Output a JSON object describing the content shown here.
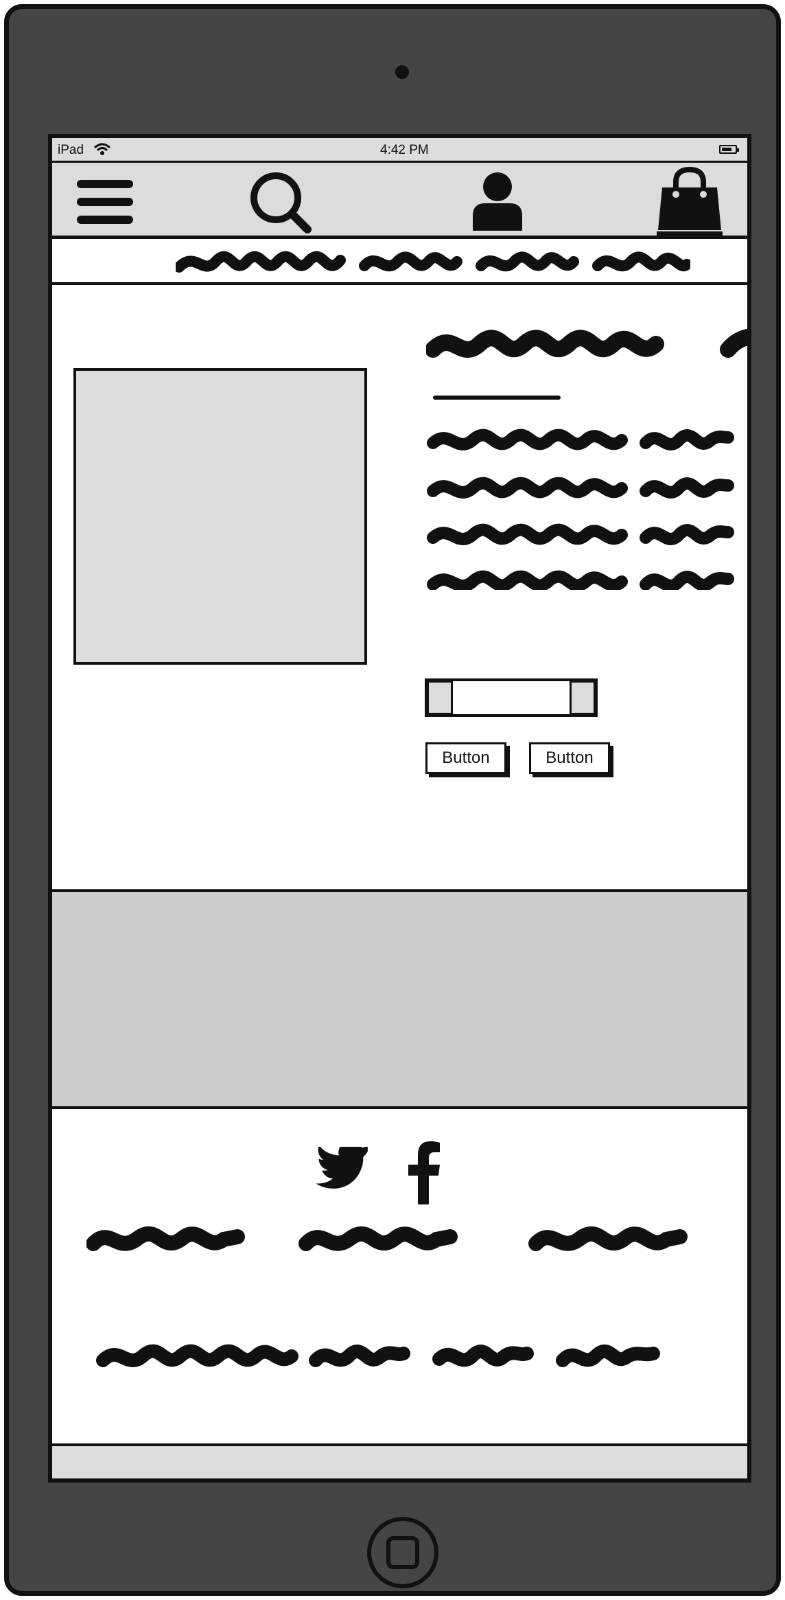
{
  "status_bar": {
    "device": "iPad",
    "time": "4:42 PM"
  },
  "product": {
    "buttons": [
      "Button",
      "Button"
    ]
  },
  "colors": {
    "device_frame": "#454545",
    "outline": "#111111",
    "panel_gray": "#dcdcdc",
    "banner_gray": "#cccccc"
  },
  "icons": {
    "nav": [
      "menu-icon",
      "search-icon",
      "user-icon",
      "shopping-bag-icon"
    ],
    "social": [
      "twitter-icon",
      "facebook-icon"
    ]
  }
}
